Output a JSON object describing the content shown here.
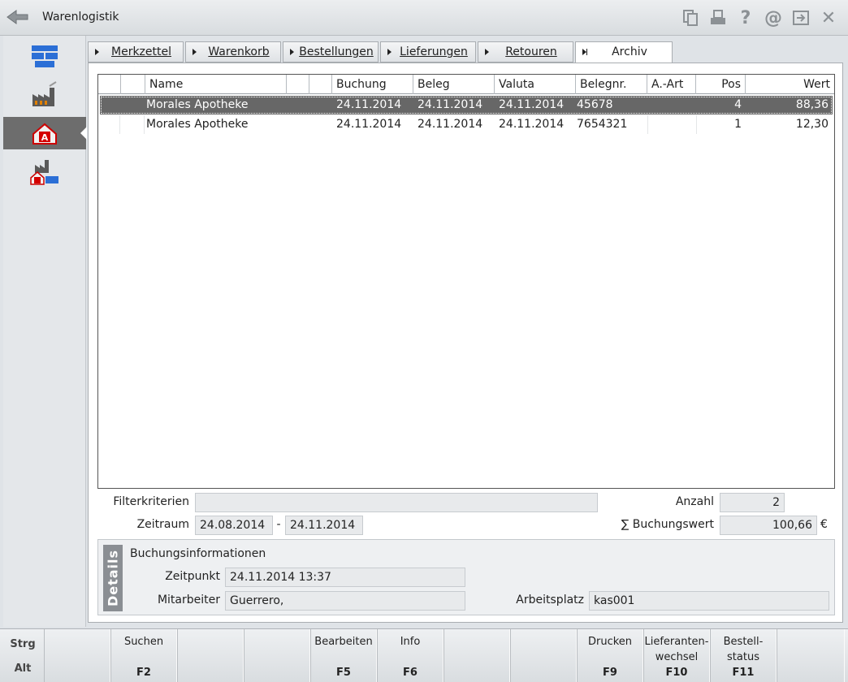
{
  "window": {
    "title": "Warenlogistik",
    "toolbar_icons": [
      "copy-icon",
      "print-icon",
      "help-icon",
      "email-icon",
      "exit-window-icon",
      "close-icon"
    ],
    "help_glyph": "?",
    "at_glyph": "@",
    "close_glyph": "✕"
  },
  "sidebar": {
    "items": [
      {
        "name": "sidebar-item-stock"
      },
      {
        "name": "sidebar-item-supplier"
      },
      {
        "name": "sidebar-item-pharmacy"
      },
      {
        "name": "sidebar-item-pharmacy-supplier"
      }
    ]
  },
  "tabs": [
    {
      "label": "Merkzettel"
    },
    {
      "label": "Warenkorb"
    },
    {
      "label": "Bestellungen"
    },
    {
      "label": "Lieferungen"
    },
    {
      "label": "Retouren"
    },
    {
      "label": "Archiv"
    }
  ],
  "table": {
    "columns": [
      "Name",
      "Buchung",
      "Beleg",
      "Valuta",
      "Belegnr.",
      "A.-Art",
      "Pos",
      "Wert"
    ],
    "rows": [
      {
        "name": "Morales Apotheke",
        "buchung": "24.11.2014",
        "beleg": "24.11.2014",
        "valuta": "24.11.2014",
        "belegnr": "45678",
        "aart": "",
        "pos": "4",
        "wert": "88,36"
      },
      {
        "name": "Morales Apotheke",
        "buchung": "24.11.2014",
        "beleg": "24.11.2014",
        "valuta": "24.11.2014",
        "belegnr": "7654321",
        "aart": "",
        "pos": "1",
        "wert": "12,30"
      }
    ]
  },
  "filter": {
    "filterkriterien_label": "Filterkriterien",
    "filterkriterien_value": "",
    "zeitraum_label": "Zeitraum",
    "zeitraum_from": "24.08.2014",
    "zeitraum_sep": "-",
    "zeitraum_to": "24.11.2014",
    "anzahl_label": "Anzahl",
    "anzahl_value": "2",
    "buchungswert_label": "∑ Buchungswert",
    "buchungswert_value": "100,66",
    "currency": "€"
  },
  "details": {
    "tab_label": "Details",
    "heading": "Buchungsinformationen",
    "zeitpunkt_label": "Zeitpunkt",
    "zeitpunkt_value": "24.11.2014 13:37",
    "mitarbeiter_label": "Mitarbeiter",
    "mitarbeiter_value": "Guerrero,",
    "arbeitsplatz_label": "Arbeitsplatz",
    "arbeitsplatz_value": "kas001"
  },
  "modifiers": {
    "strg": "Strg",
    "alt": "Alt"
  },
  "fkeys": [
    {
      "label": "",
      "key": ""
    },
    {
      "label": "Suchen",
      "key": "F2"
    },
    {
      "label": "",
      "key": ""
    },
    {
      "label": "",
      "key": ""
    },
    {
      "label": "Bearbeiten",
      "key": "F5"
    },
    {
      "label": "Info",
      "key": "F6"
    },
    {
      "label": "",
      "key": ""
    },
    {
      "label": "",
      "key": ""
    },
    {
      "label": "Drucken",
      "key": "F9"
    },
    {
      "label": "Lieferanten-\nwechsel",
      "key": "F10"
    },
    {
      "label": "Bestell-\nstatus",
      "key": "F11"
    },
    {
      "label": "",
      "key": ""
    }
  ]
}
